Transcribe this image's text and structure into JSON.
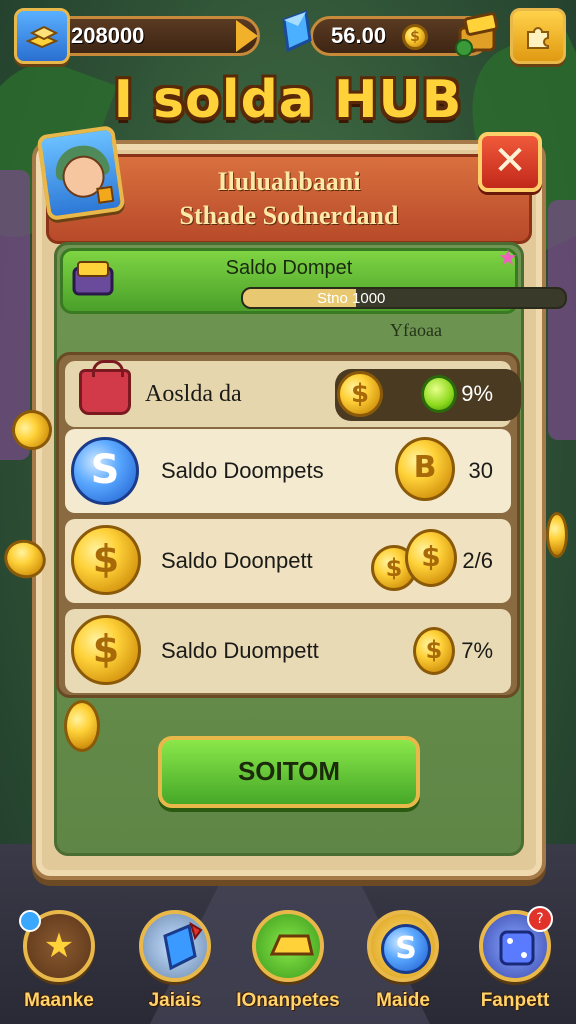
{
  "topbar": {
    "currency_value": "208000",
    "gems_value": "56.00"
  },
  "title": "I solda HUB",
  "panel": {
    "header_line1": "Iluluahbaani",
    "header_line2": "Sthade Sodnerdand",
    "wallet_label": "Saldo Dompet",
    "wallet_bar_text": "Stno 1000",
    "wallet_progress": 0.35,
    "sub_caption": "Yfaoaa",
    "rows": [
      {
        "label": "Aoslda da",
        "value": "9%",
        "icon": "red-bag-icon"
      },
      {
        "label": "Saldo Doompets",
        "value": "30",
        "icon": "blue-s-coin-icon"
      },
      {
        "label": "Saldo Doonpett",
        "value": "2/6",
        "icon": "dollar-coin-icon"
      },
      {
        "label": "Saldo Duompett",
        "value": "7%",
        "icon": "dollar-coin-icon"
      }
    ],
    "button_label": "SOITOM"
  },
  "nav": {
    "items": [
      {
        "label": "Maanke",
        "icon": "star-icon"
      },
      {
        "label": "Jaiais",
        "icon": "blue-gem-icon"
      },
      {
        "label": "IOnanpetes",
        "icon": "gold-bar-icon"
      },
      {
        "label": "Maide",
        "icon": "s-coin-icon"
      },
      {
        "label": "Fanpett",
        "icon": "dice-icon"
      }
    ]
  },
  "colors": {
    "gold": "#ffd23a",
    "panel": "#e2c99a",
    "inner_green": "#6f9552",
    "button_green": "#6ac83a",
    "close_red": "#d83a2a",
    "accent_blue": "#2d78d6"
  }
}
